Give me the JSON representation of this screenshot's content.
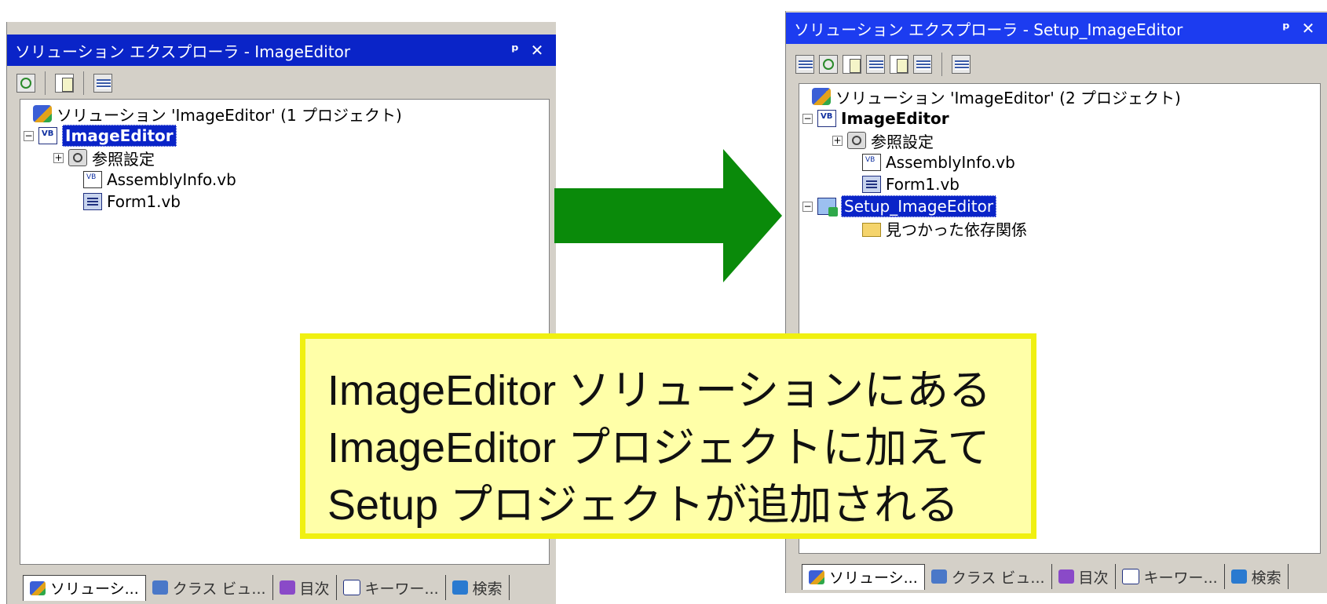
{
  "left_panel": {
    "title": "ソリューション エクスプローラ - ImageEditor",
    "pin_glyph": "ᵖ",
    "close_glyph": "✕",
    "tree": {
      "solution": "ソリューション 'ImageEditor' (1 プロジェクト)",
      "project": "ImageEditor",
      "references": "参照設定",
      "assembly_info": "AssemblyInfo.vb",
      "form": "Form1.vb"
    },
    "tabs": [
      "ソリューシ...",
      "クラス ビュ...",
      "目次",
      "キーワー...",
      "検索"
    ]
  },
  "right_panel": {
    "title": "ソリューション エクスプローラ - Setup_ImageEditor",
    "pin_glyph": "ᵖ",
    "close_glyph": "✕",
    "tree": {
      "solution": "ソリューション 'ImageEditor' (2 プロジェクト)",
      "project": "ImageEditor",
      "references": "参照設定",
      "assembly_info": "AssemblyInfo.vb",
      "form": "Form1.vb",
      "setup_project": "Setup_ImageEditor",
      "found_dependencies": "見つかった依存関係"
    },
    "tabs": [
      "ソリューシ...",
      "クラス ビュ...",
      "目次",
      "キーワー...",
      "検索"
    ]
  },
  "callout": {
    "lines": [
      "ImageEditor ソリューションにある",
      "ImageEditor プロジェクトに加えて",
      "Setup プロジェクトが追加される"
    ]
  },
  "colors": {
    "arrow": "#0a8a0a",
    "titlebar": "#0a24c8",
    "callout_fill": "#ffffa8",
    "callout_border": "#f0f010"
  },
  "icons": [
    "refresh-icon",
    "properties-icon",
    "view-all-icon",
    "solution-icon",
    "project-icon",
    "references-icon",
    "file-icon",
    "form-icon",
    "setup-project-icon",
    "folder-icon"
  ]
}
